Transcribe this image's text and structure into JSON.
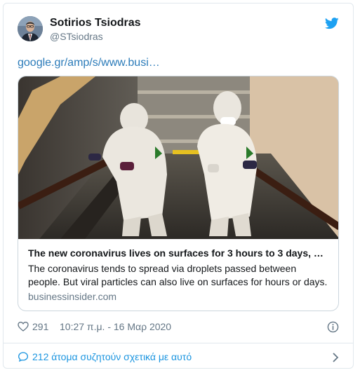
{
  "author": {
    "display_name": "Sotirios Tsiodras",
    "handle": "@STsiodras"
  },
  "tweet": {
    "link_text": "google.gr/amp/s/www.busi…"
  },
  "card": {
    "title": "The new coronavirus lives on surfaces for 3 hours to 3 days, …",
    "description": "The coronavirus tends to spread via droplets passed between people. But viral particles can also live on surfaces for hours or days.",
    "domain": "businessinsider.com"
  },
  "meta": {
    "likes": "291",
    "timestamp": "10:27 π.μ. - 16 Μαρ 2020"
  },
  "footer": {
    "discussion": "212 άτομα συζητούν σχετικά με αυτό"
  },
  "colors": {
    "link": "#2b7bb9",
    "twitter_blue": "#1da1f2",
    "muted": "#657786",
    "border": "#e1e8ed"
  },
  "icons": [
    "twitter-bird-icon",
    "heart-icon",
    "info-icon",
    "speech-bubble-icon",
    "chevron-right-icon"
  ]
}
